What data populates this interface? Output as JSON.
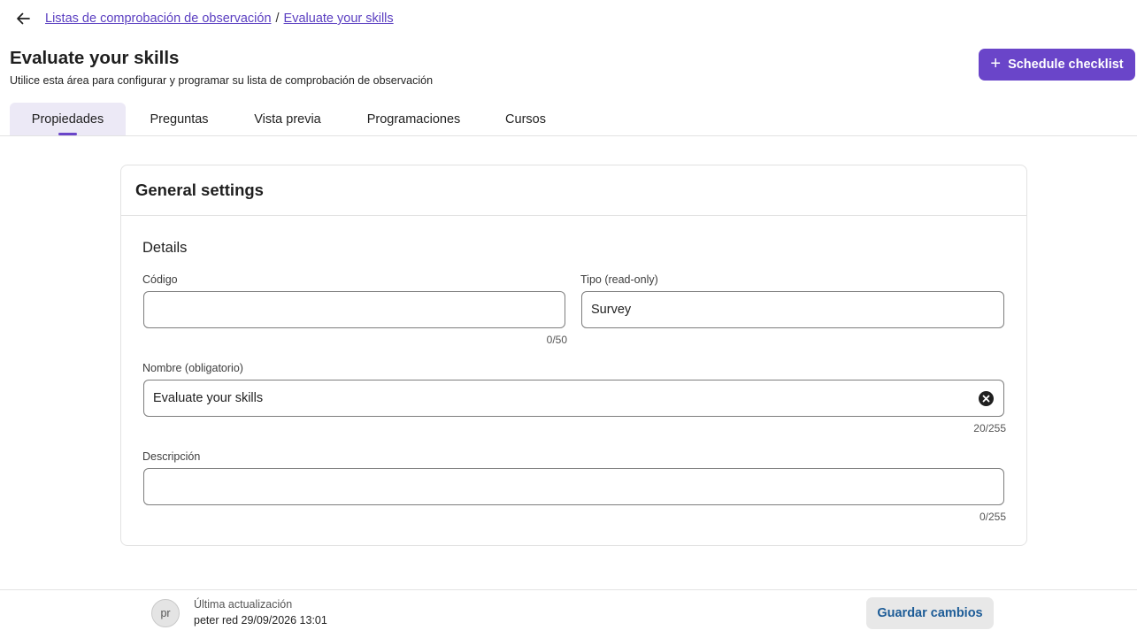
{
  "breadcrumb": {
    "back_icon": "arrow-left-icon",
    "parent": "Listas de comprobación de observación",
    "separator": "/",
    "current": "Evaluate your skills"
  },
  "header": {
    "title": "Evaluate your skills",
    "subtitle": "Utilice esta área para configurar y programar su lista de comprobación de observación",
    "schedule_button": {
      "icon": "plus-icon",
      "label": "Schedule checklist"
    }
  },
  "tabs": [
    {
      "label": "Propiedades",
      "active": true
    },
    {
      "label": "Preguntas",
      "active": false
    },
    {
      "label": "Vista previa",
      "active": false
    },
    {
      "label": "Programaciones",
      "active": false
    },
    {
      "label": "Cursos",
      "active": false
    }
  ],
  "card": {
    "title": "General settings",
    "section": "Details",
    "fields": {
      "codigo": {
        "label": "Código",
        "value": "",
        "counter": "0/50"
      },
      "tipo": {
        "label": "Tipo (read-only)",
        "value": "Survey"
      },
      "nombre": {
        "label": "Nombre (obligatorio)",
        "value": "Evaluate your skills",
        "counter": "20/255",
        "clear_icon": "close-circle-icon"
      },
      "descripcion": {
        "label": "Descripción",
        "value": "",
        "counter": "0/255"
      }
    }
  },
  "footer": {
    "avatar_initials": "pr",
    "updated_label": "Última actualización",
    "updated_value": "peter red 29/09/2026 13:01",
    "save_button": "Guardar cambios"
  },
  "colors": {
    "accent": "#6a45c9",
    "link": "#5b3fc1",
    "save_text": "#1d5c97"
  }
}
